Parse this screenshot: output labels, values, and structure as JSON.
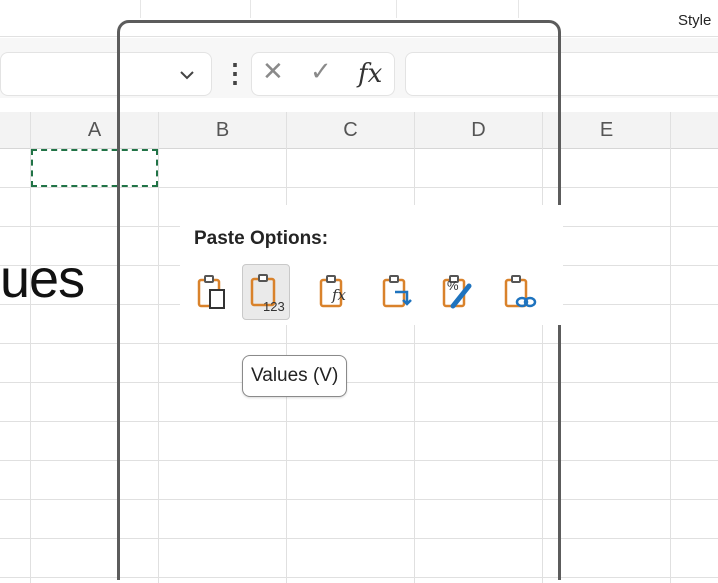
{
  "ribbon": {
    "styles_label": "Style"
  },
  "formula_bar": {
    "name_box_chevron": "chevron-down",
    "more_dots": "⋮",
    "cancel": "✕",
    "enter": "✓",
    "function": "fx",
    "formula_value": ""
  },
  "columns": [
    "A",
    "B",
    "C",
    "D",
    "E"
  ],
  "sheet": {
    "partial_text": "ues"
  },
  "paste_options": {
    "title": "Paste Options:",
    "items": [
      {
        "name": "paste",
        "label": ""
      },
      {
        "name": "values",
        "label": "123"
      },
      {
        "name": "formulas",
        "label": "fx"
      },
      {
        "name": "transpose",
        "label": ""
      },
      {
        "name": "formatting",
        "label": "%"
      },
      {
        "name": "paste-link",
        "label": ""
      }
    ],
    "active_index": 1,
    "tooltip": "Values (V)"
  },
  "colors": {
    "accent_orange": "#d9822b",
    "accent_blue": "#1e73be",
    "selection_green": "#217346"
  }
}
